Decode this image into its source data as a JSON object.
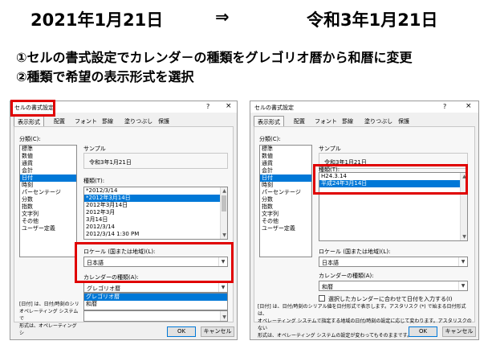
{
  "headline": {
    "from_date": "2021年1月21日",
    "arrow": "⇒",
    "to_date": "令和3年1月21日"
  },
  "steps": [
    "①セルの書式設定でカレンダ－の種類をグレゴリオ暦から和暦に変更",
    "②種類で希望の表示形式を選択"
  ],
  "highlight_color": "#e00000",
  "left_dialog": {
    "title": "セルの書式設定",
    "help": "?",
    "close": "×",
    "tabs": [
      "表示形式",
      "配置",
      "フォント",
      "罫線",
      "塗りつぶし",
      "保護"
    ],
    "category_label": "分類(C):",
    "categories": [
      "標準",
      "数値",
      "通貨",
      "会計",
      "日付",
      "時刻",
      "パーセンテージ",
      "分数",
      "指数",
      "文字列",
      "その他",
      "ユーザー定義"
    ],
    "selected_category": "日付",
    "sample_label": "サンプル",
    "sample_value": "令和3年1月21日",
    "type_label": "種類(T):",
    "types": [
      "*2012/3/14",
      "*2012年3月14日",
      "2012年3月14日",
      "2012年3月",
      "3月14日",
      "2012/3/14",
      "2012/3/14 1:30 PM"
    ],
    "selected_type": "*2012年3月14日",
    "locale_label": "ロケール (国または地域)(L):",
    "locale_value": "日本語",
    "calendar_label": "カレンダーの種類(A):",
    "calendar_value": "グレゴリオ暦",
    "calendar_options": [
      "グレゴリオ暦",
      "和暦"
    ],
    "calendar_option_selected": "グレゴリオ暦",
    "description": [
      "[日付] は、日付/時刻のシリ",
      "オペレーティング システムで",
      "形式は、オペレーティング シ"
    ],
    "ok_label": "OK",
    "cancel_label": "キャンセル"
  },
  "right_dialog": {
    "title": "セルの書式設定",
    "help": "?",
    "close": "×",
    "tabs": [
      "表示形式",
      "配置",
      "フォント",
      "罫線",
      "塗りつぶし",
      "保護"
    ],
    "category_label": "分類(C):",
    "categories": [
      "標準",
      "数値",
      "通貨",
      "会計",
      "日付",
      "時刻",
      "パーセンテージ",
      "分数",
      "指数",
      "文字列",
      "その他",
      "ユーザー定義"
    ],
    "selected_category": "日付",
    "sample_label": "サンプル",
    "sample_value": "令和3年1月21日",
    "type_label": "種類(T):",
    "types": [
      "H24.3.14",
      "平成24年3月14日"
    ],
    "selected_type": "平成24年3月14日",
    "locale_label": "ロケール (国または地域)(L):",
    "locale_value": "日本語",
    "calendar_label": "カレンダーの種類(A):",
    "calendar_value": "和暦",
    "checkbox_label": "選択したカレンダーに合わせて日付を入力する(I)",
    "description": [
      "[日付] は、日付/時刻のシリアル値を日付形式で表示します。アスタリスク (*) で始まる日付形式は、",
      "オペレーティング システムで指定する地域の日付/時刻の設定に応じて変わります。アスタリスクのない",
      "形式は、オペレーティング システムの設定が変わってもそのままです。"
    ],
    "ok_label": "OK",
    "cancel_label": "キャンセル"
  }
}
